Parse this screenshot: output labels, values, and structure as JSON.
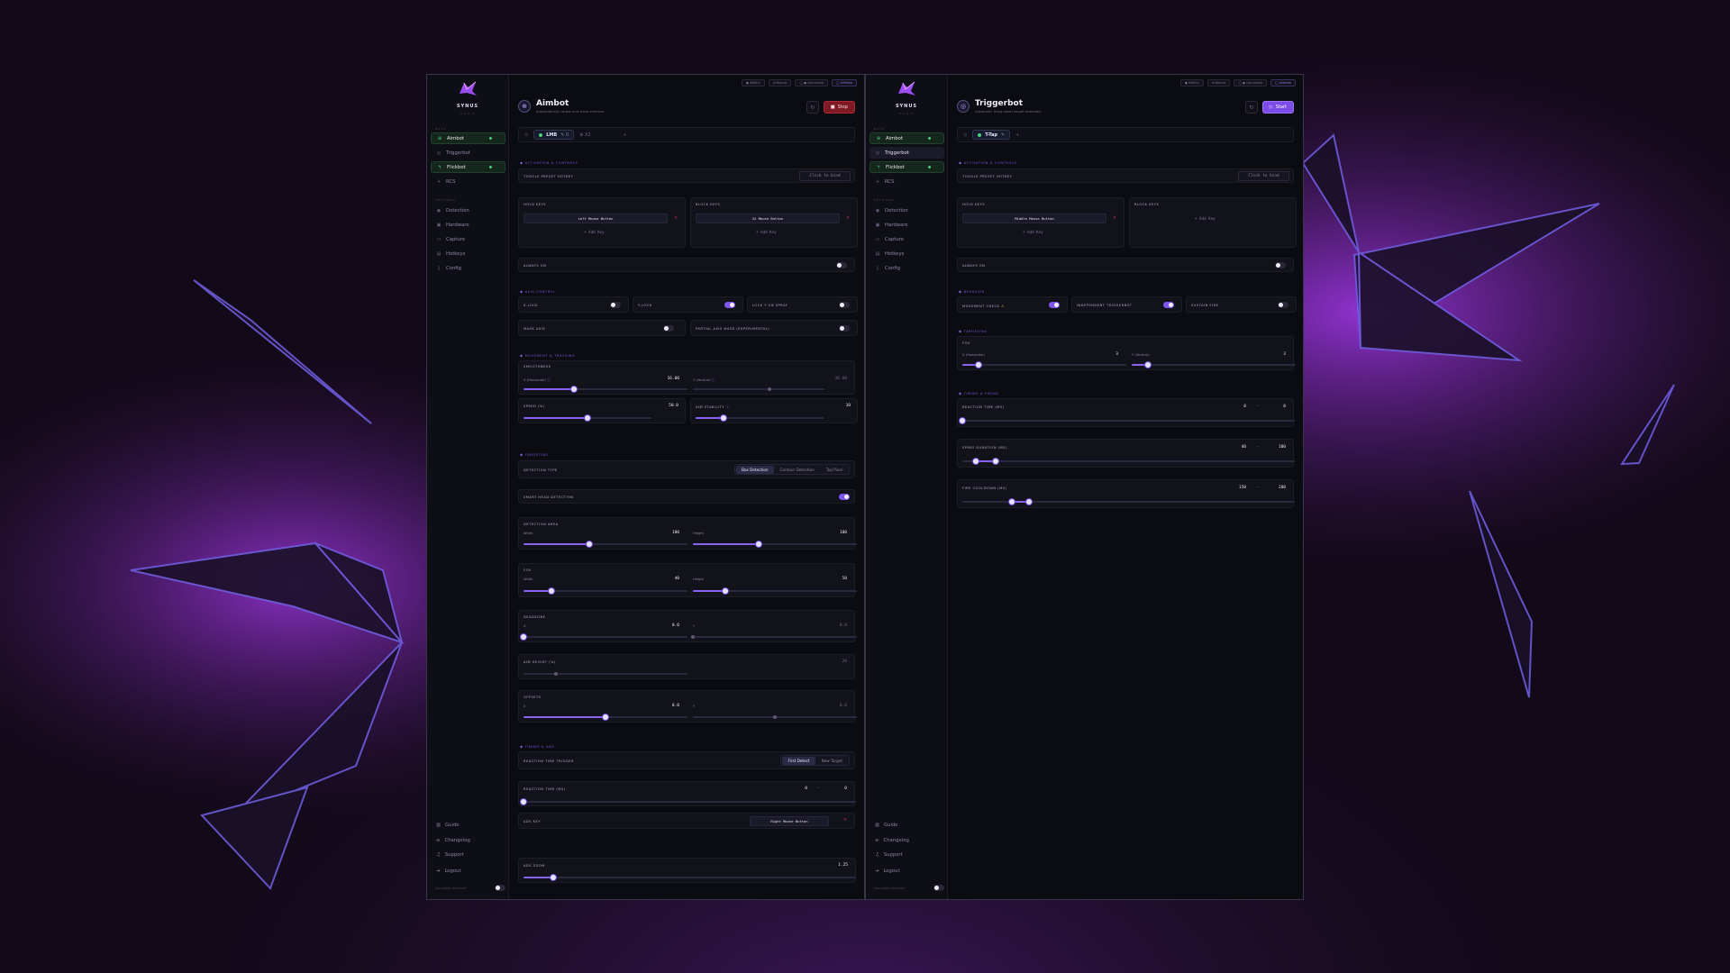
{
  "brand": {
    "name": "SYNUS",
    "sub": "V1.0.0",
    "accent": "#8a63f0",
    "logo_icon": "dragon-logo-icon"
  },
  "sidebar": {
    "sections": {
      "bots": "BOTS",
      "settings": "SETTINGS"
    },
    "bots": [
      {
        "label": "Aimbot",
        "icon": "crosshair-icon"
      },
      {
        "label": "Triggerbot",
        "icon": "target-icon"
      },
      {
        "label": "Flickbot",
        "icon": "bolt-icon"
      },
      {
        "label": "RCS",
        "icon": "move-icon"
      }
    ],
    "settings": [
      {
        "label": "Detection",
        "icon": "eye-icon"
      },
      {
        "label": "Hardware",
        "icon": "cpu-icon"
      },
      {
        "label": "Capture",
        "icon": "monitor-icon"
      },
      {
        "label": "Hotkeys",
        "icon": "keyboard-icon"
      },
      {
        "label": "Config",
        "icon": "file-icon"
      }
    ],
    "footer": [
      {
        "label": "Guide",
        "icon": "book-icon"
      },
      {
        "label": "Changelog",
        "icon": "list-icon"
      },
      {
        "label": "Support",
        "icon": "headset-icon"
      },
      {
        "label": "Logout",
        "icon": "logout-icon"
      }
    ],
    "auto_update": "Auto-apply detected"
  },
  "topbar": {
    "pills": [
      "● MAKCU",
      "⊡ Normal",
      "◯ ● Connected",
      "◯ Lifetime"
    ]
  },
  "aimbot": {
    "title": "Aimbot",
    "subtitle": "Automatically target and track enemies",
    "action": "Stop",
    "presets": [
      {
        "name": "LMB",
        "meta": "✎ 0"
      },
      {
        "name": "⊕ X2"
      }
    ],
    "groups": {
      "activation": "Activation & Controls",
      "axis": "Axis Control",
      "movement": "Movement & Tracking",
      "targeting": "Targeting",
      "timing": "Timing & ADS"
    },
    "toggle_preset_hotkey": "TOGGLE PRESET HOTKEY",
    "click_to_bind": "Click to bind",
    "hold_keys": {
      "label": "HOLD KEYS",
      "key": "Left Mouse Button",
      "add": "+ Add Key"
    },
    "block_keys": {
      "label": "BLOCK KEYS",
      "key": "X2 Mouse Button",
      "add": "+ Add Key"
    },
    "always_on": {
      "label": "ALWAYS ON",
      "on": false
    },
    "axis": [
      {
        "label": "X-LOCK",
        "on": false
      },
      {
        "label": "Y-LOCK",
        "on": true
      },
      {
        "label": "LOCK Y ON SPRAY",
        "on": false
      },
      {
        "label": "MASK AXIS",
        "on": false
      },
      {
        "label": "PARTIAL AXIS MASK (EXPERIMENTAL)",
        "on": false
      }
    ],
    "smoothness": {
      "label": "SMOOTHNESS",
      "x": {
        "label": "X (Horizontal)",
        "value": "16.00",
        "frac": 0.31
      },
      "y": {
        "label": "Y (Vertical)",
        "value": "30.00",
        "frac": 0.58
      }
    },
    "speed": {
      "label": "SPEED (%)",
      "value": "50.0",
      "frac": 0.5
    },
    "aim_stability": {
      "label": "AIM STABILITY",
      "value": "10",
      "frac": 0.22
    },
    "detection_type": {
      "label": "DETECTION TYPE",
      "options": [
        "Box Detection",
        "Contour Detection",
        "Top Pixel"
      ],
      "selected": 0
    },
    "smart_head": {
      "label": "SMART HEAD DETECTION",
      "on": true
    },
    "detection_area": {
      "label": "DETECTION AREA",
      "width": {
        "label": "Width",
        "value": "100",
        "frac": 0.4
      },
      "height": {
        "label": "Height",
        "value": "100",
        "frac": 0.4
      }
    },
    "fov": {
      "label": "FOV",
      "width": {
        "label": "Width",
        "value": "40",
        "frac": 0.17
      },
      "height": {
        "label": "Height",
        "value": "50",
        "frac": 0.2
      }
    },
    "deadzone": {
      "label": "DEADZONE",
      "x": {
        "label": "X",
        "value": "0.0",
        "frac": 0.0
      },
      "y": {
        "label": "Y",
        "value": "0.0",
        "frac": 0.0
      }
    },
    "aim_height": {
      "label": "AIM HEIGHT (%)",
      "value": "20",
      "frac": 0.2
    },
    "offsets": {
      "label": "OFFSETS",
      "x": {
        "label": "X",
        "value": "0.0",
        "frac": 0.5
      },
      "y": {
        "label": "Y",
        "value": "0.0",
        "frac": 0.5
      }
    },
    "reaction_trigger": {
      "label": "REACTION TIME TRIGGER",
      "options": [
        "First Detect",
        "New Target"
      ],
      "selected": 0
    },
    "reaction_time": {
      "label": "REACTION TIME (MS)",
      "min": "0",
      "max": "0"
    },
    "ads_key": {
      "label": "ADS KEY",
      "key": "Right Mouse Button"
    },
    "ads_zoom": {
      "label": "ADS ZOOM",
      "value": "1.25",
      "frac": 0.09
    }
  },
  "triggerbot": {
    "title": "Triggerbot",
    "subtitle": "Automatic firing when target detected",
    "action": "Start",
    "presets": [
      {
        "name": "T-Tap",
        "meta": "✎"
      }
    ],
    "groups": {
      "activation": "Activation & Controls",
      "behavior": "Behavior",
      "targeting": "Targeting",
      "timing": "Timing & Firing"
    },
    "toggle_preset_hotkey": "TOGGLE PRESET HOTKEY",
    "click_to_bind": "Click to bind",
    "hold_keys": {
      "label": "HOLD KEYS",
      "key": "Middle Mouse Button",
      "add": "+ Add Key"
    },
    "block_keys": {
      "label": "BLOCK KEYS",
      "add": "+ Add Key"
    },
    "always_on": {
      "label": "ALWAYS ON",
      "on": false
    },
    "behavior": [
      {
        "label": "MOVEMENT CHECK",
        "on": true
      },
      {
        "label": "INDEPENDENT TRIGGERBOT",
        "on": true
      },
      {
        "label": "SUSTAIN FIRE",
        "on": false
      }
    ],
    "fov": {
      "label": "FOV",
      "x": {
        "label": "X (Horizontal)",
        "value": "3",
        "frac": 0.1
      },
      "y": {
        "label": "Y (Vertical)",
        "value": "3",
        "frac": 0.1
      }
    },
    "reaction_time": {
      "label": "REACTION TIME (MS)",
      "min": "0",
      "max": "0",
      "lo": 0.0,
      "hi": 0.0
    },
    "spray_duration": {
      "label": "SPRAY DURATION (MS)",
      "min": "40",
      "max": "100",
      "lo": 0.04,
      "hi": 0.1
    },
    "fire_cooldown": {
      "label": "FIRE COOLDOWN (MS)",
      "min": "150",
      "max": "200",
      "lo": 0.15,
      "hi": 0.2
    }
  }
}
